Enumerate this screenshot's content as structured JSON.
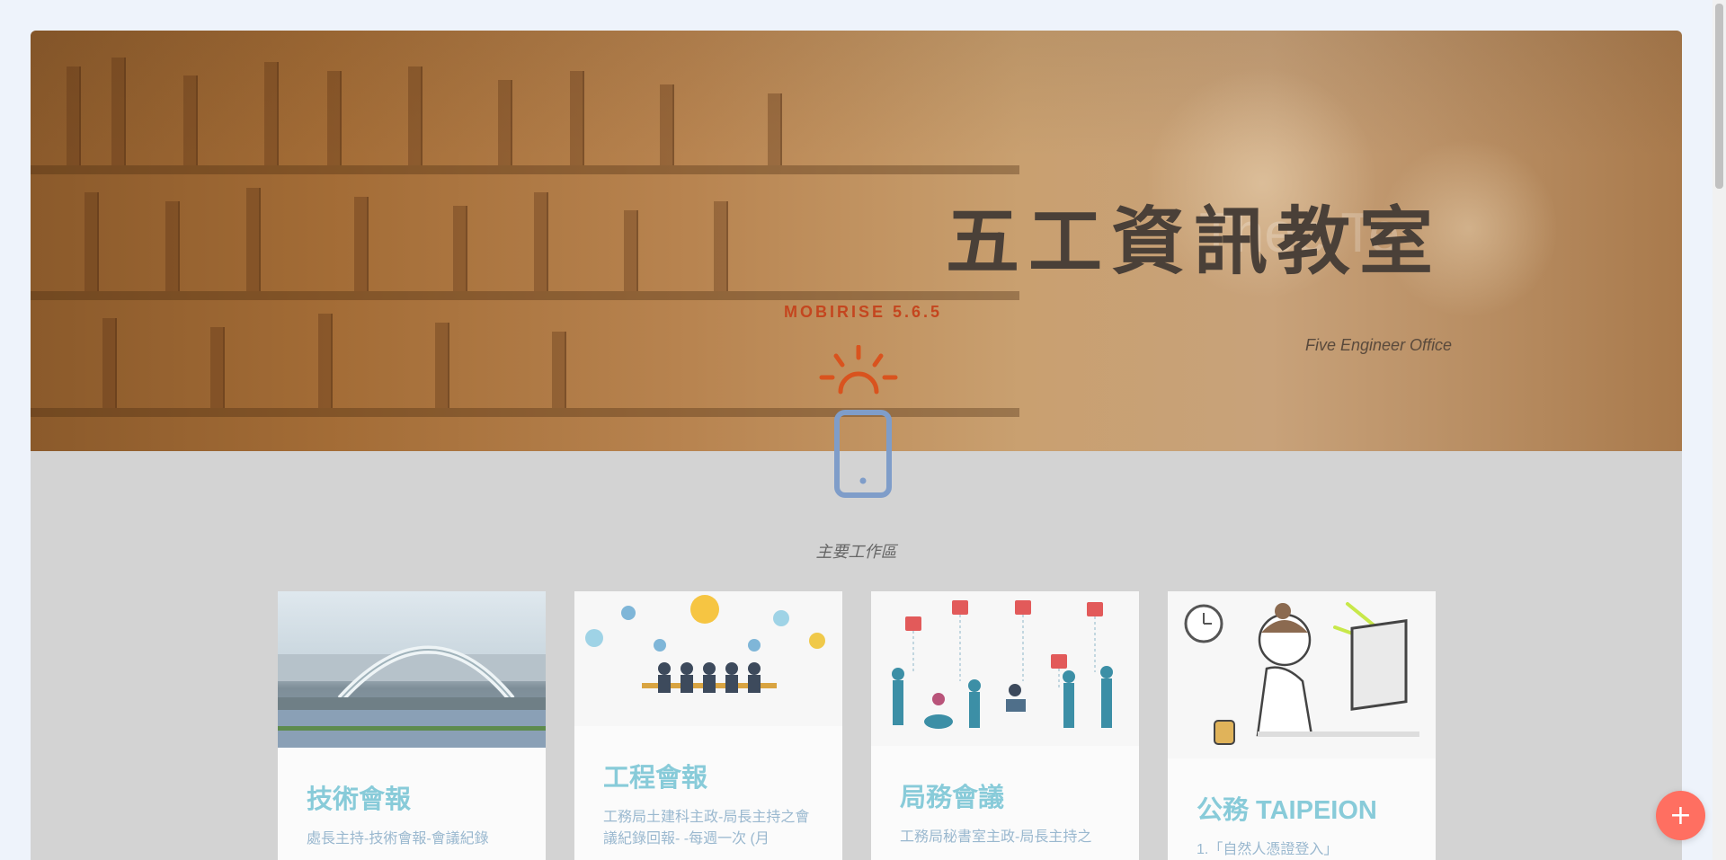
{
  "hero": {
    "title": "五工資訊教室",
    "faint_overlay": "Thee Te",
    "subtitle": "Five Engineer Office",
    "brand": "MOBIRISE 5.6.5"
  },
  "section": {
    "title": "主要工作區"
  },
  "cards": [
    {
      "title": "技術會報",
      "text": "處長主持-技術會報-會議紀錄"
    },
    {
      "title": "工程會報",
      "text": "工務局土建科主政-局長主持之會議紀錄回報- -每週一次 (月"
    },
    {
      "title": "局務會議",
      "text": "工務局秘書室主政-局長主持之"
    },
    {
      "title": "公務 TAIPEION",
      "text": "1.「自然人憑證登入」"
    }
  ],
  "fab": {
    "label": "+"
  },
  "colors": {
    "brand_accent": "#c4461f",
    "card_title": "#88cbd9",
    "fab": "#ff6f61"
  }
}
